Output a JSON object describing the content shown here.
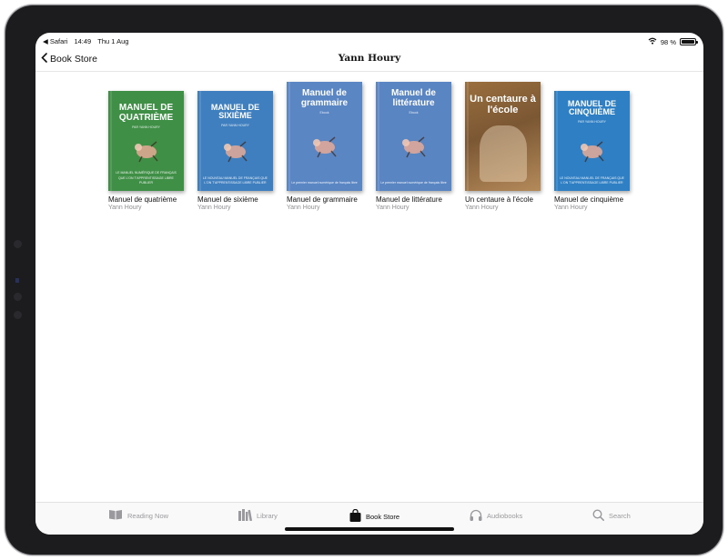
{
  "status_bar": {
    "back_app": "◀ Safari",
    "time": "14:49",
    "date": "Thu 1 Aug",
    "battery": "98 %",
    "battery_level": 0.98
  },
  "nav": {
    "back_label": "Book Store",
    "title": "Yann Houry"
  },
  "books": [
    {
      "title": "Manuel de quatrième",
      "author": "Yann Houry",
      "cover_title": "MANUEL DE QUATRIÈME",
      "cover_sub": "PAR YANN HOURY",
      "cover_foot": "LE MANUEL NUMÉRIQUE DE FRANÇAIS QUE L'ON T'APPRENTISSAGE LIBRE PUBLIER",
      "cover_color": "#3f8f46"
    },
    {
      "title": "Manuel de sixième",
      "author": "Yann Houry",
      "cover_title": "MANUEL DE SIXIÈME",
      "cover_sub": "PAR YANN HOURY",
      "cover_foot": "LE NOUVEAU MANUEL DE FRANÇAIS QUE L'ON T'APPRENTISSAGE LIBRE PUBLIER",
      "cover_color": "#3f7fbf"
    },
    {
      "title": "Manuel de grammaire",
      "author": "Yann Houry",
      "cover_title": "Manuel de grammaire",
      "cover_sub": "Ebook",
      "cover_foot": "Le premier manuel numérique de français libre",
      "cover_color": "#5b86c4"
    },
    {
      "title": "Manuel de littérature",
      "author": "Yann Houry",
      "cover_title": "Manuel de littérature",
      "cover_sub": "Ebook",
      "cover_foot": "Le premier manuel numérique de français libre",
      "cover_color": "#5a85c3"
    },
    {
      "title": "Un centaure à l'école",
      "author": "Yann Houry",
      "cover_title": "Un centaure à l'école",
      "cover_sub": "",
      "cover_foot": "",
      "cover_color": "#8a6a3e"
    },
    {
      "title": "Manuel de cinquième",
      "author": "Yann Houry",
      "cover_title": "MANUEL DE CINQUIÈME",
      "cover_sub": "PAR YANN HOURY",
      "cover_foot": "LE NOUVEAU MANUEL DE FRANÇAIS QUE L'ON T'APPRENTISSAGE LIBRE PUBLIER",
      "cover_color": "#2f7fc4"
    }
  ],
  "tabs": [
    {
      "label": "Reading Now",
      "icon": "book-open-icon",
      "active": false
    },
    {
      "label": "Library",
      "icon": "library-icon",
      "active": false
    },
    {
      "label": "Book Store",
      "icon": "shopping-bag-icon",
      "active": true
    },
    {
      "label": "Audiobooks",
      "icon": "headphones-icon",
      "active": false
    },
    {
      "label": "Search",
      "icon": "search-icon",
      "active": false
    }
  ]
}
